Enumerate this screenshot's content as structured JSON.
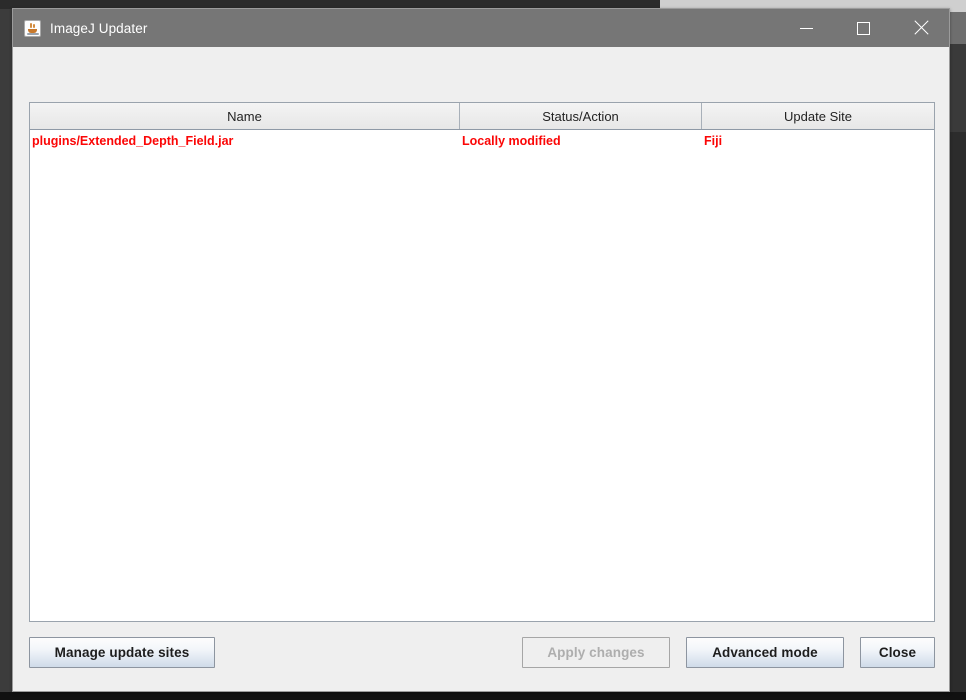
{
  "window": {
    "title": "ImageJ Updater",
    "icon": "java-coffee-cup-icon",
    "controls": {
      "minimize": "minimize-icon",
      "maximize": "maximize-icon",
      "close": "close-icon"
    }
  },
  "table": {
    "columns": [
      {
        "key": "name",
        "label": "Name"
      },
      {
        "key": "status",
        "label": "Status/Action"
      },
      {
        "key": "site",
        "label": "Update Site"
      }
    ],
    "rows": [
      {
        "name": "plugins/Extended_Depth_Field.jar",
        "status": "Locally modified",
        "site": "Fiji"
      }
    ],
    "row_text_color": "#fb0606"
  },
  "footer": {
    "manage_label": "Manage update sites",
    "apply_label": "Apply changes",
    "apply_enabled": false,
    "advanced_label": "Advanced mode",
    "close_label": "Close"
  }
}
